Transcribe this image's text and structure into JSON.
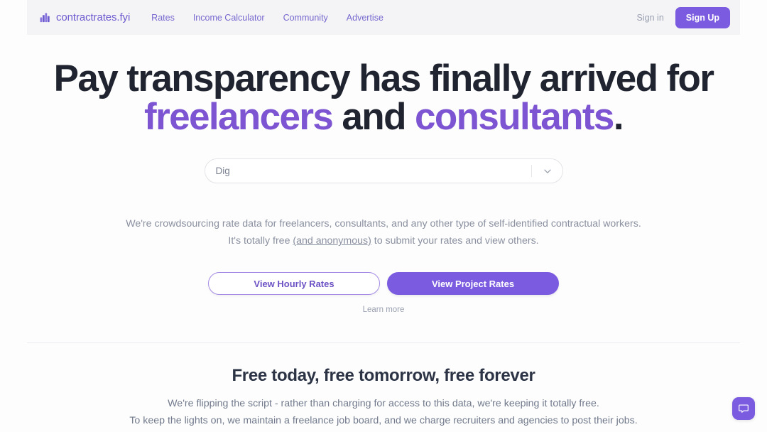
{
  "header": {
    "brand": {
      "icon": "bar-chart-icon",
      "name": "contractrates.fyi"
    },
    "nav": [
      {
        "label": "Rates"
      },
      {
        "label": "Income Calculator"
      },
      {
        "label": "Community"
      },
      {
        "label": "Advertise"
      }
    ],
    "signin_label": "Sign in",
    "signup_label": "Sign Up"
  },
  "hero": {
    "headline": {
      "line1": "Pay transparency has finally arrived for",
      "line2_part1": "freelancers",
      "line2_part2": " and ",
      "line2_part3": "consultants",
      "line2_part4": "."
    },
    "search": {
      "value": "Dig",
      "placeholder": "Dig",
      "chevron_icon": "chevron-down-icon"
    },
    "subcopy": {
      "line1": "We're crowdsourcing rate data for freelancers, consultants, and any other type of self-identified contractual workers.",
      "line2_before": "It's totally free ",
      "line2_link": "(and anonymous)",
      "line2_after": " to submit your rates and view others."
    },
    "cta": {
      "hourly_label": "View Hourly Rates",
      "project_label": "View Project Rates",
      "learn_more_label": "Learn more"
    }
  },
  "lower": {
    "title": "Free today, free tomorrow, free forever",
    "line1": "We're flipping the script - rather than charging for access to this data, we're keeping it totally free.",
    "line2": "To keep the lights on, we maintain a freelance job board, and we charge recruiters and agencies to post their jobs."
  },
  "chat": {
    "icon": "chat-bubble-icon"
  },
  "colors": {
    "brand_purple": "#6d5bd0",
    "accent_purple": "#7b5ce0",
    "headline_purple": "#7d54d1",
    "headline_dark": "#1f2430",
    "header_bg": "#f4f4f6",
    "muted_text": "#8a90a0"
  }
}
